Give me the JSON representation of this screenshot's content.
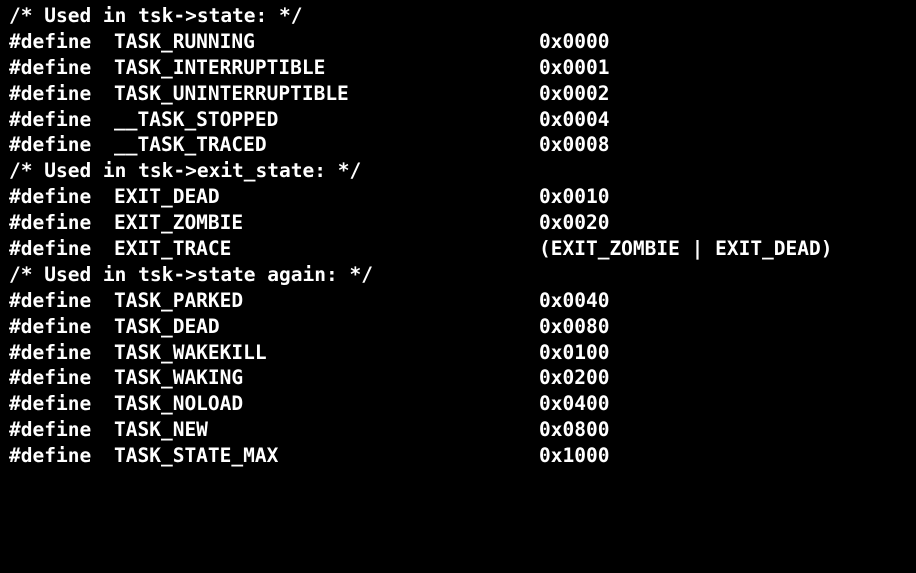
{
  "lines": [
    {
      "type": "comment",
      "text": "/* Used in tsk->state: */"
    },
    {
      "type": "define",
      "keyword": "#define",
      "name": "TASK_RUNNING",
      "value": "0x0000"
    },
    {
      "type": "define",
      "keyword": "#define",
      "name": "TASK_INTERRUPTIBLE",
      "value": "0x0001"
    },
    {
      "type": "define",
      "keyword": "#define",
      "name": "TASK_UNINTERRUPTIBLE",
      "value": "0x0002"
    },
    {
      "type": "define",
      "keyword": "#define",
      "name": "__TASK_STOPPED",
      "value": "0x0004"
    },
    {
      "type": "define",
      "keyword": "#define",
      "name": "__TASK_TRACED",
      "value": "0x0008"
    },
    {
      "type": "comment",
      "text": "/* Used in tsk->exit_state: */"
    },
    {
      "type": "define",
      "keyword": "#define",
      "name": "EXIT_DEAD",
      "value": "0x0010"
    },
    {
      "type": "define",
      "keyword": "#define",
      "name": "EXIT_ZOMBIE",
      "value": "0x0020"
    },
    {
      "type": "define",
      "keyword": "#define",
      "name": "EXIT_TRACE",
      "value": "(EXIT_ZOMBIE | EXIT_DEAD)"
    },
    {
      "type": "comment",
      "text": "/* Used in tsk->state again: */"
    },
    {
      "type": "define",
      "keyword": "#define",
      "name": "TASK_PARKED",
      "value": "0x0040"
    },
    {
      "type": "define",
      "keyword": "#define",
      "name": "TASK_DEAD",
      "value": "0x0080"
    },
    {
      "type": "define",
      "keyword": "#define",
      "name": "TASK_WAKEKILL",
      "value": "0x0100"
    },
    {
      "type": "define",
      "keyword": "#define",
      "name": "TASK_WAKING",
      "value": "0x0200"
    },
    {
      "type": "define",
      "keyword": "#define",
      "name": "TASK_NOLOAD",
      "value": "0x0400"
    },
    {
      "type": "define",
      "keyword": "#define",
      "name": "TASK_NEW",
      "value": "0x0800"
    },
    {
      "type": "define",
      "keyword": "#define",
      "name": "TASK_STATE_MAX",
      "value": "0x1000"
    }
  ],
  "colors": {
    "background": "#000000",
    "text": "#ffffff"
  }
}
